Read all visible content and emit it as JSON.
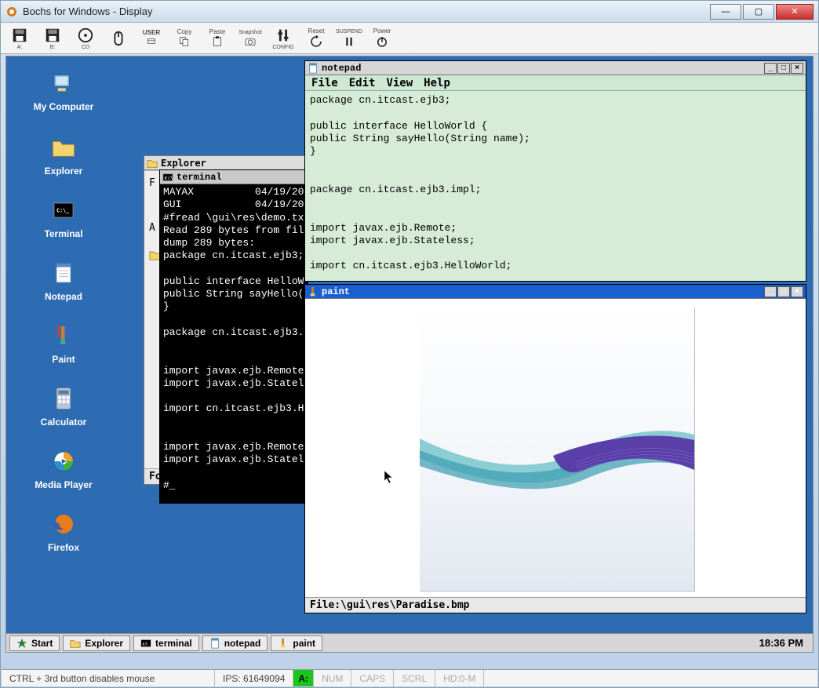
{
  "host": {
    "title": "Bochs for Windows - Display",
    "toolbar": [
      {
        "name": "floppy-a",
        "label": "A:"
      },
      {
        "name": "floppy-b",
        "label": "B:"
      },
      {
        "name": "cdrom",
        "label": "CD"
      },
      {
        "name": "mouse",
        "label": ""
      },
      {
        "name": "user",
        "label": "USER"
      },
      {
        "name": "copy",
        "label": "Copy"
      },
      {
        "name": "paste",
        "label": "Paste"
      },
      {
        "name": "snapshot",
        "label": "Snapshot"
      },
      {
        "name": "config",
        "label": "CONFIG"
      },
      {
        "name": "reset",
        "label": "Reset"
      },
      {
        "name": "suspend",
        "label": "SUSPEND"
      },
      {
        "name": "power",
        "label": "Power"
      }
    ],
    "status": {
      "mouse_hint": "CTRL + 3rd button disables mouse",
      "ips_label": "IPS:",
      "ips_value": "61649094",
      "drive": "A:",
      "indicators": [
        "NUM",
        "CAPS",
        "SCRL",
        "HD:0-M"
      ]
    }
  },
  "desktop_icons": [
    {
      "name": "my-computer",
      "label": "My Computer"
    },
    {
      "name": "explorer",
      "label": "Explorer"
    },
    {
      "name": "terminal",
      "label": "Terminal"
    },
    {
      "name": "notepad",
      "label": "Notepad"
    },
    {
      "name": "paint",
      "label": "Paint"
    },
    {
      "name": "calculator",
      "label": "Calculator"
    },
    {
      "name": "media-player",
      "label": "Media Player"
    },
    {
      "name": "firefox",
      "label": "Firefox"
    }
  ],
  "explorer": {
    "title": "Explorer"
  },
  "terminal": {
    "title": "terminal",
    "content": "MAYAX          04/19/201\nGUI            04/19/201\n#fread \\gui\\res\\demo.tx\nRead 289 bytes from fil\ndump 289 bytes:\npackage cn.itcast.ejb3;\n\npublic interface HelloW\npublic String sayHello(\n}\n\npackage cn.itcast.ejb3.\n\n\nimport javax.ejb.Remote\nimport javax.ejb.Statel\n\nimport cn.itcast.ejb3.H\n\n\nimport javax.ejb.Remote\nimport javax.ejb.Statel\n\n#_"
  },
  "notepad": {
    "title": "notepad",
    "menu": [
      "File",
      "Edit",
      "View",
      "Help"
    ],
    "content": "package cn.itcast.ejb3;\n\npublic interface HelloWorld {\npublic String sayHello(String name);\n}\n\n\npackage cn.itcast.ejb3.impl;\n\n\nimport javax.ejb.Remote;\nimport javax.ejb.Stateless;\n\nimport cn.itcast.ejb3.HelloWorld;"
  },
  "paint": {
    "title": "paint",
    "status": "File:\\gui\\res\\Paradise.bmp"
  },
  "taskbar": {
    "start": "Start",
    "items": [
      {
        "name": "explorer",
        "label": "Explorer"
      },
      {
        "name": "terminal",
        "label": "terminal"
      },
      {
        "name": "notepad",
        "label": "notepad"
      },
      {
        "name": "paint",
        "label": "paint"
      }
    ],
    "clock": "18:36 PM"
  }
}
